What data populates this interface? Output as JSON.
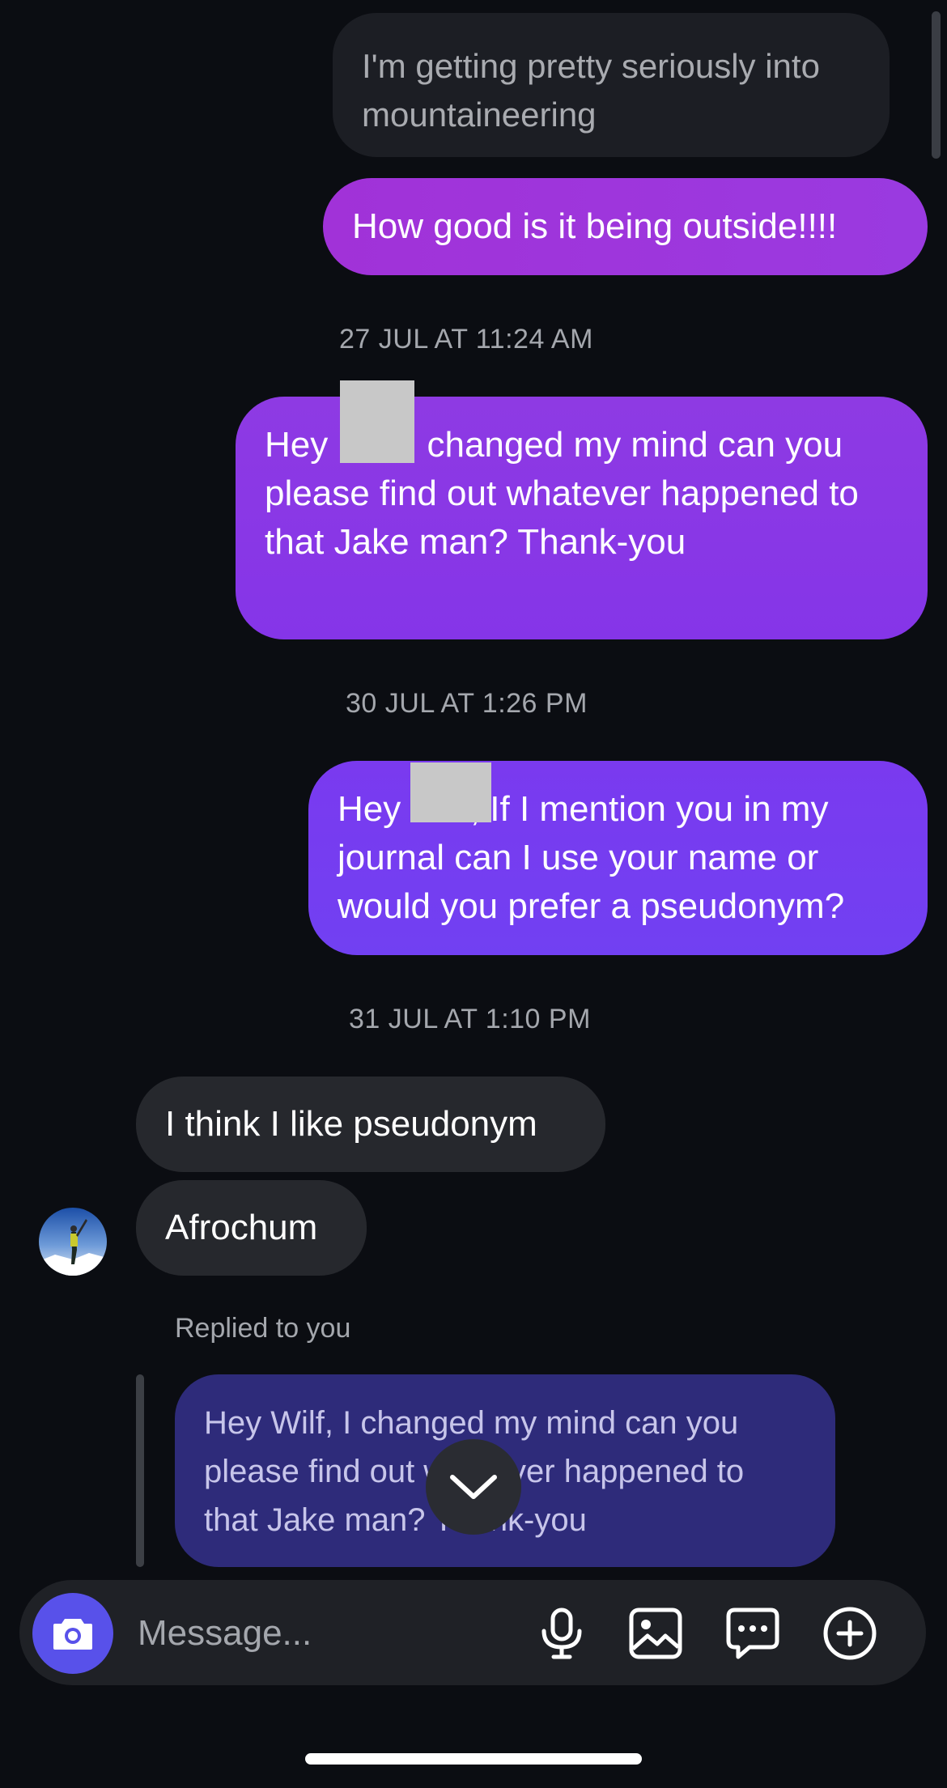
{
  "messages": {
    "m1": "I'm getting pretty seriously into mountaineering",
    "m2": "How good is it being outside!!!!",
    "ts1": "27 JUL AT 11:24 AM",
    "m3": "Hey      , I changed my mind can you please find out whatever happened to that Jake man? Thank-you",
    "ts2": "30 JUL AT 1:26 PM",
    "m4": "Hey       , If I mention you in my journal can I use your name or would you prefer a pseudonym?",
    "ts3": "31 JUL AT 1:10 PM",
    "m5": "I think I like pseudonym",
    "m6": "Afrochum"
  },
  "reply": {
    "label": "Replied to you",
    "quoted": "Hey Wilf, I changed my mind can you please find out whatever happened to that Jake man? Thank-you"
  },
  "composer": {
    "placeholder": "Message...",
    "icons": [
      "camera-icon",
      "microphone-icon",
      "gallery-icon",
      "chat-bubble-icon",
      "plus-circle-icon"
    ]
  },
  "colors": {
    "accent": "#5851ea",
    "sent_bubble_1": "#a132d8",
    "sent_bubble_2": "#8e3ae3",
    "sent_bubble_3": "#7a3aef",
    "received_bubble": "#26282d",
    "reply_bubble": "#2e2b7a",
    "background": "#0b0d12"
  }
}
